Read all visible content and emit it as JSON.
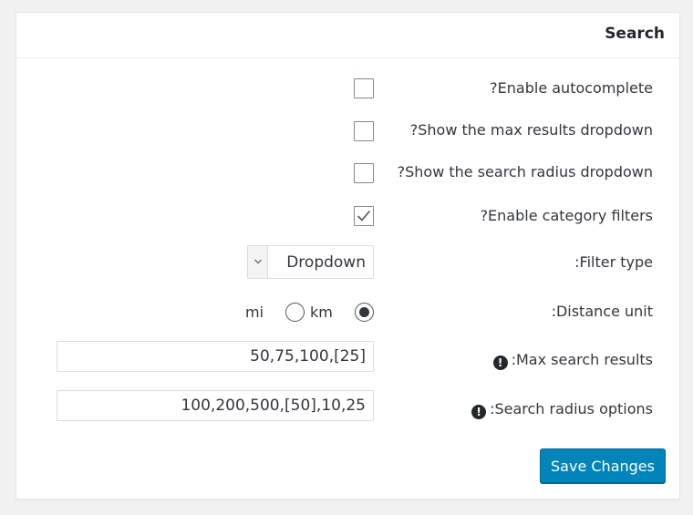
{
  "panel": {
    "title": "Search"
  },
  "settings": {
    "enable_autocomplete": {
      "label": "?Enable autocomplete",
      "checked": false
    },
    "show_max_results": {
      "label": "?Show the max results dropdown",
      "checked": false
    },
    "show_search_radius": {
      "label": "?Show the search radius dropdown",
      "checked": false
    },
    "enable_category_filters": {
      "label": "?Enable category filters",
      "checked": true
    },
    "filter_type": {
      "label": ":Filter type",
      "selected": "Dropdown"
    },
    "distance_unit": {
      "label": ":Distance unit",
      "options": [
        "mi",
        "km"
      ],
      "selected": "mi"
    },
    "max_search_results": {
      "label": ":Max search results",
      "value": "50,75,100,[25]"
    },
    "search_radius_options": {
      "label": ":Search radius options",
      "value": "100,200,500,[50],10,25"
    }
  },
  "actions": {
    "save_label": "Save Changes"
  },
  "colors": {
    "primary_button": "#0085ba",
    "panel_background": "#ffffff",
    "page_background": "#f1f1f1"
  },
  "icons": {
    "help": "exclamation-circle-icon",
    "select_arrow": "chevron-down-icon",
    "checkmark": "checkmark-icon"
  }
}
